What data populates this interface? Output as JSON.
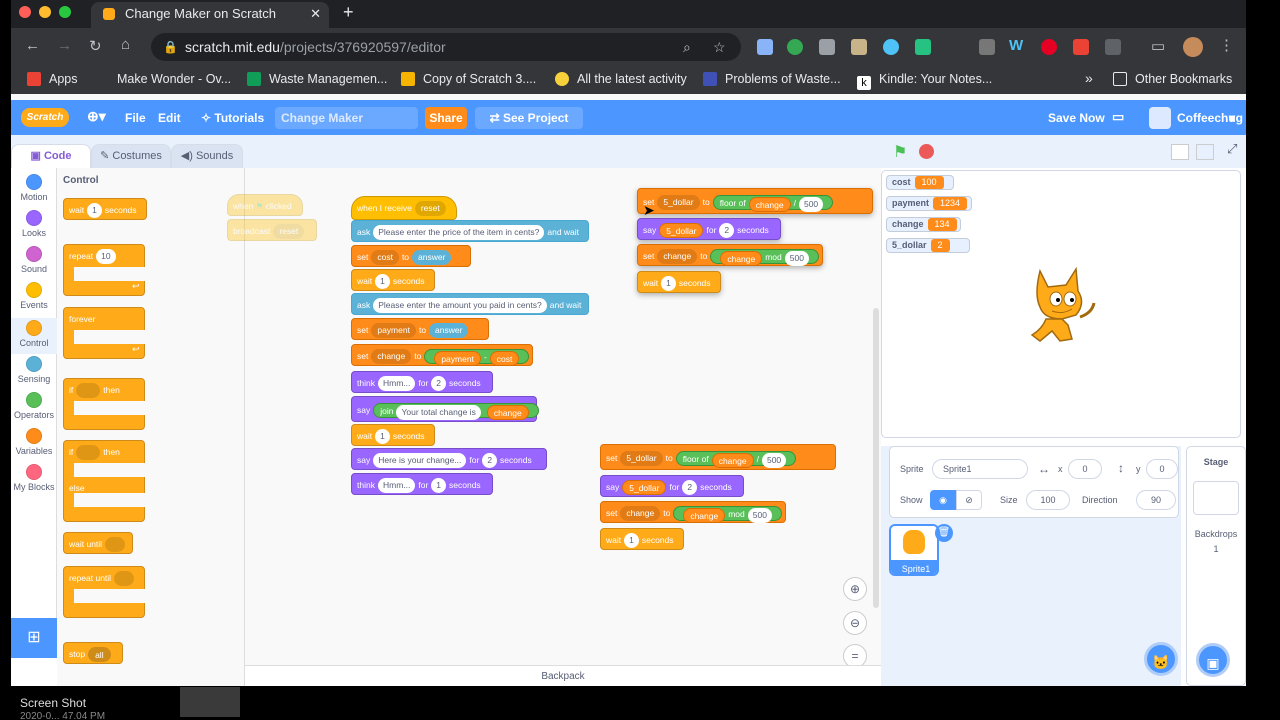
{
  "browser": {
    "tab_title": "Change Maker on Scratch",
    "url_domain": "scratch.mit.edu",
    "url_path": "/projects/376920597/editor",
    "bookmarks": [
      "Apps",
      "Make Wonder - Ov...",
      "Waste Managemen...",
      "Copy of Scratch 3....",
      "All the latest activity",
      "Problems of Waste...",
      "Kindle: Your Notes..."
    ],
    "other_bookmarks": "Other Bookmarks",
    "bookmark_overflow": "»"
  },
  "menu": {
    "logo": "Scratch",
    "file": "File",
    "edit": "Edit",
    "tutorials": "Tutorials",
    "project_title": "Change Maker",
    "share": "Share",
    "see_project_page": "See Project Page",
    "save_now": "Save Now",
    "username": "Coffeechug"
  },
  "editor_tabs": {
    "code": "Code",
    "costumes": "Costumes",
    "sounds": "Sounds"
  },
  "categories": [
    {
      "label": "Motion",
      "color": "#4c97ff"
    },
    {
      "label": "Looks",
      "color": "#9966ff"
    },
    {
      "label": "Sound",
      "color": "#cf63cf"
    },
    {
      "label": "Events",
      "color": "#ffbf00"
    },
    {
      "label": "Control",
      "color": "#ffab19"
    },
    {
      "label": "Sensing",
      "color": "#5cb1d6"
    },
    {
      "label": "Operators",
      "color": "#59c059"
    },
    {
      "label": "Variables",
      "color": "#ff8c1a"
    },
    {
      "label": "My Blocks",
      "color": "#ff6680"
    }
  ],
  "palette": {
    "heading": "Control",
    "wait": "wait",
    "wait_val": "1",
    "seconds": "seconds",
    "repeat": "repeat",
    "repeat_val": "10",
    "forever": "forever",
    "if": "if",
    "then": "then",
    "else": "else",
    "wait_until": "wait until",
    "repeat_until": "repeat until",
    "stop": "stop",
    "stop_val": "all"
  },
  "ghost": {
    "when": "when",
    "clicked": "clicked",
    "broadcast": "broadcast",
    "reset": "reset"
  },
  "script1": {
    "when_i_receive": "when I receive",
    "reset": "reset",
    "ask": "ask",
    "and_wait": "and wait",
    "q1": "Please enter the price of the item in cents?",
    "q2": "Please enter the amount you paid in cents?",
    "set": "set",
    "to": "to",
    "wait": "wait",
    "seconds": "seconds",
    "for": "for",
    "cost": "cost",
    "answer": "answer",
    "one": "1",
    "two": "2",
    "payment": "payment",
    "change": "change",
    "minus": "-",
    "think": "think",
    "hmm": "Hmm...",
    "say": "say",
    "join": "join",
    "total": "Your total change is",
    "here": "Here is your change..."
  },
  "script2": {
    "set": "set",
    "five_dollar": "5_dollar",
    "to": "to",
    "floor": "floor",
    "of": "of",
    "change": "change",
    "div": "/",
    "five_hundred": "500",
    "say": "say",
    "for": "for",
    "two": "2",
    "seconds": "seconds",
    "mod": "mod",
    "wait": "wait",
    "one": "1"
  },
  "monitors": [
    {
      "name": "cost",
      "value": "100"
    },
    {
      "name": "payment",
      "value": "1234"
    },
    {
      "name": "change",
      "value": "134"
    },
    {
      "name": "5_dollar",
      "value": "2"
    }
  ],
  "sprite_info": {
    "sprite_label": "Sprite",
    "sprite_name": "Sprite1",
    "x_label": "x",
    "x_val": "0",
    "y_label": "y",
    "y_val": "0",
    "show_label": "Show",
    "size_label": "Size",
    "size_val": "100",
    "direction_label": "Direction",
    "direction_val": "90",
    "thumb_label": "Sprite1"
  },
  "stage_panel": {
    "title": "Stage",
    "backdrops": "Backdrops",
    "count": "1"
  },
  "backpack": "Backpack",
  "desktop": {
    "screenshot_label": "Screen Shot",
    "screenshot_sub": "2020-0... 47.04 PM"
  }
}
